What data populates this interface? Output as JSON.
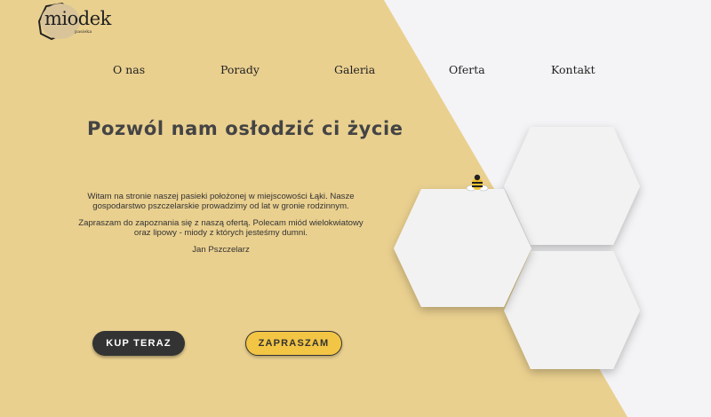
{
  "logo": {
    "word": "miodek",
    "sub": "pasieka"
  },
  "nav": {
    "items": [
      {
        "label": "O nas"
      },
      {
        "label": "Porady"
      },
      {
        "label": "Galeria"
      },
      {
        "label": "Oferta"
      },
      {
        "label": "Kontakt"
      }
    ]
  },
  "hero": {
    "headline": "Pozwól nam osłodzić ci życie",
    "paragraphs": [
      "Witam na stronie naszej pasieki położonej w miejscowości Łąki. Nasze gospodarstwo pszczelarskie prowadzimy od lat w gronie rodzinnym.",
      "Zapraszam do zapoznania się z naszą ofertą. Polecam miód wielokwiatowy oraz lipowy - miody z których jesteśmy dumni.",
      "Jan Pszczelarz"
    ],
    "buy_label": "KUP TERAZ",
    "invite_label": "ZAPRASZAM"
  },
  "colors": {
    "background_yellow": "#ead08f",
    "background_light": "#f4f4f6",
    "accent_yellow": "#f3c545",
    "dark": "#333333",
    "hexagon": "#f2f2f2"
  },
  "icons": {
    "logo_mark": "hexagon-logo-icon",
    "bee": "bee-icon"
  }
}
